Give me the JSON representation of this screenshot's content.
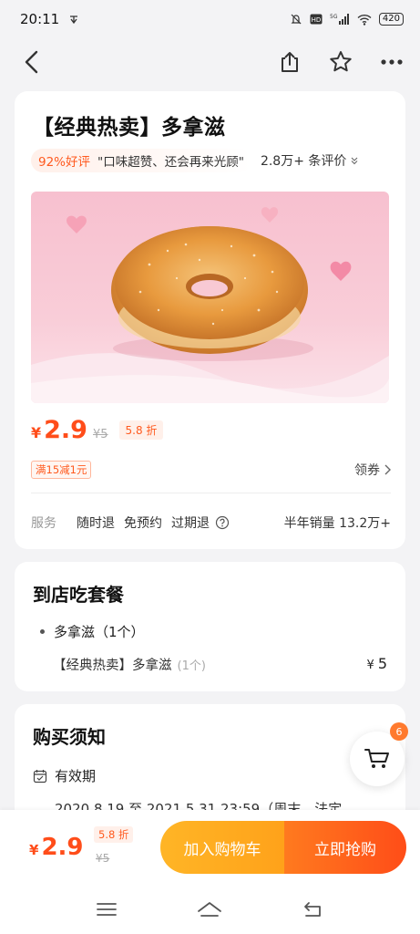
{
  "status": {
    "time": "20:11",
    "battery": "420",
    "network": "5G"
  },
  "product": {
    "title": "【经典热卖】多拿滋",
    "rating_pct": "92%好评",
    "rating_quote": "\"口味超赞、还会再来光顾\"",
    "review_count": "2.8万+ 条评价",
    "price_symbol": "¥",
    "price": "2.9",
    "original_price": "¥5",
    "discount": "5.8 折",
    "coupon_tag": "满15减1元",
    "get_coupon": "领券",
    "service_label": "服务",
    "services": [
      "随时退",
      "免预约",
      "过期退"
    ],
    "sales": "半年销量 13.2万+"
  },
  "package": {
    "title": "到店吃套餐",
    "item_name": "多拿滋（1个）",
    "sub_name": "【经典热卖】多拿滋",
    "sub_qty": "(1个)",
    "price_symbol": "¥",
    "price": "5"
  },
  "notice": {
    "title": "购买须知",
    "validity_label": "有效期",
    "validity_date": "2020.8.19 至 2021.5.31 23:59（周末、法定"
  },
  "cart": {
    "badge": "6"
  },
  "bottom": {
    "price_symbol": "¥",
    "price": "2.9",
    "discount": "5.8 折",
    "original_price": "¥5",
    "add_cart": "加入购物车",
    "buy_now": "立即抢购"
  },
  "colors": {
    "accent": "#ff4d1a",
    "cart_button": "#ffa21a",
    "buy_button": "#ff5a1a"
  }
}
